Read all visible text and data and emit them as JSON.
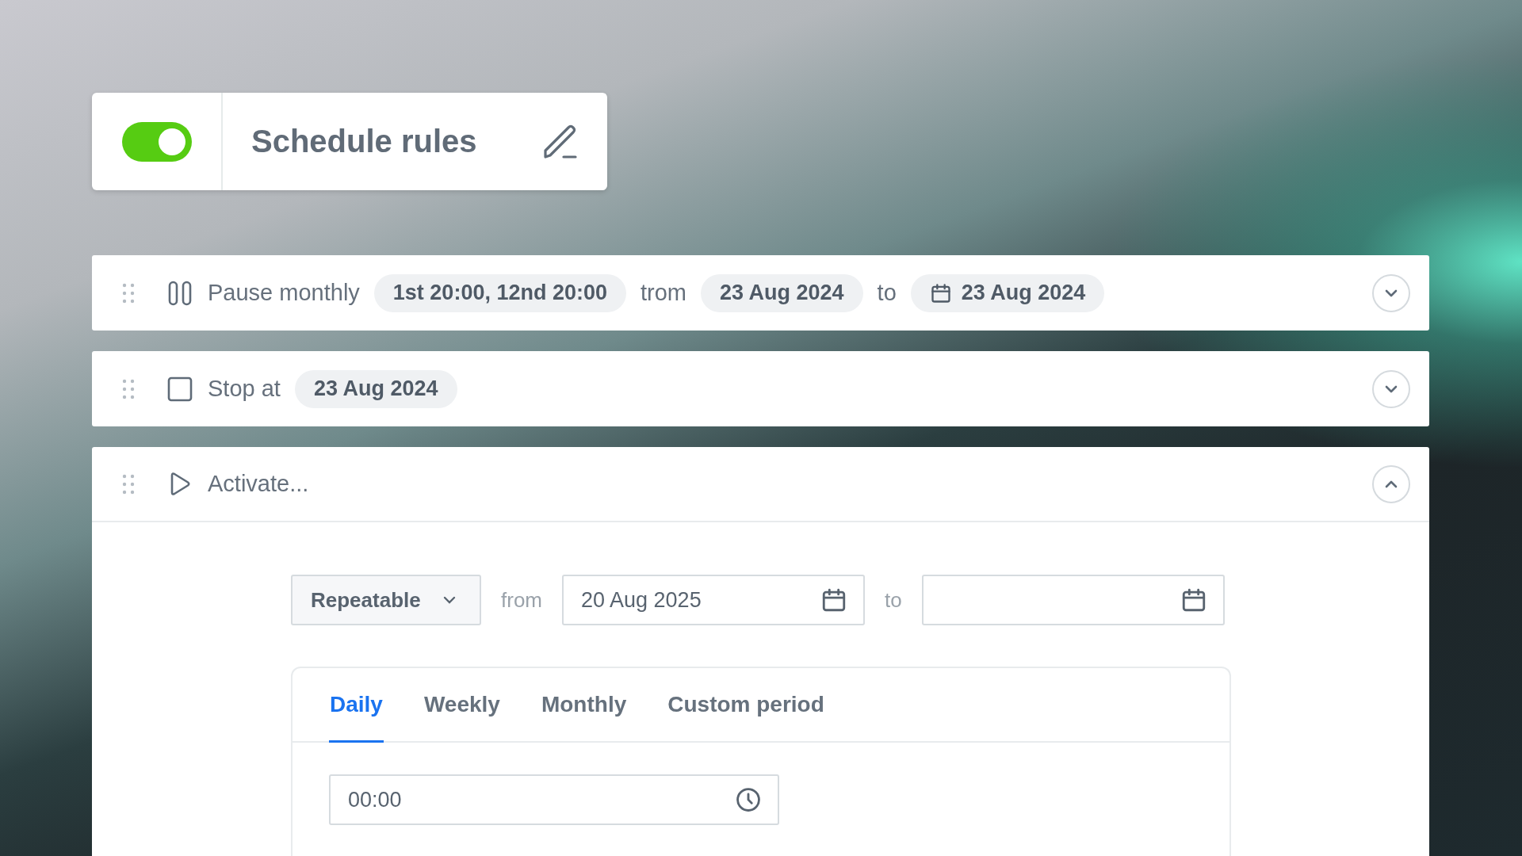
{
  "header": {
    "on": true,
    "title": "Schedule rules"
  },
  "rules": [
    {
      "kind": "pause",
      "expanded": false,
      "parts": [
        {
          "kind": "label",
          "text": "Pause monthly"
        },
        {
          "kind": "chip",
          "text": "1st 20:00, 12nd 20:00"
        },
        {
          "kind": "label",
          "text": "trom"
        },
        {
          "kind": "chip",
          "text": "23 Aug 2024"
        },
        {
          "kind": "label",
          "text": "to"
        },
        {
          "kind": "date-chip",
          "text": "23 Aug 2024"
        }
      ]
    },
    {
      "kind": "stop",
      "expanded": false,
      "parts": [
        {
          "kind": "label",
          "text": "Stop at"
        },
        {
          "kind": "chip",
          "text": "23 Aug 2024"
        }
      ]
    },
    {
      "kind": "activate",
      "expanded": true,
      "parts": [
        {
          "kind": "label",
          "text": "Activate..."
        }
      ]
    }
  ],
  "activation": {
    "mode": "Repeatable",
    "from_label": "from",
    "from_date": "20 Aug 2025",
    "to_label": "to",
    "tabs": [
      {
        "label": "Daily",
        "selected": true
      },
      {
        "label": "Weekly",
        "selected": false
      },
      {
        "label": "Monthly",
        "selected": false
      },
      {
        "label": "Custom period",
        "selected": false
      }
    ],
    "time": "00:00"
  }
}
